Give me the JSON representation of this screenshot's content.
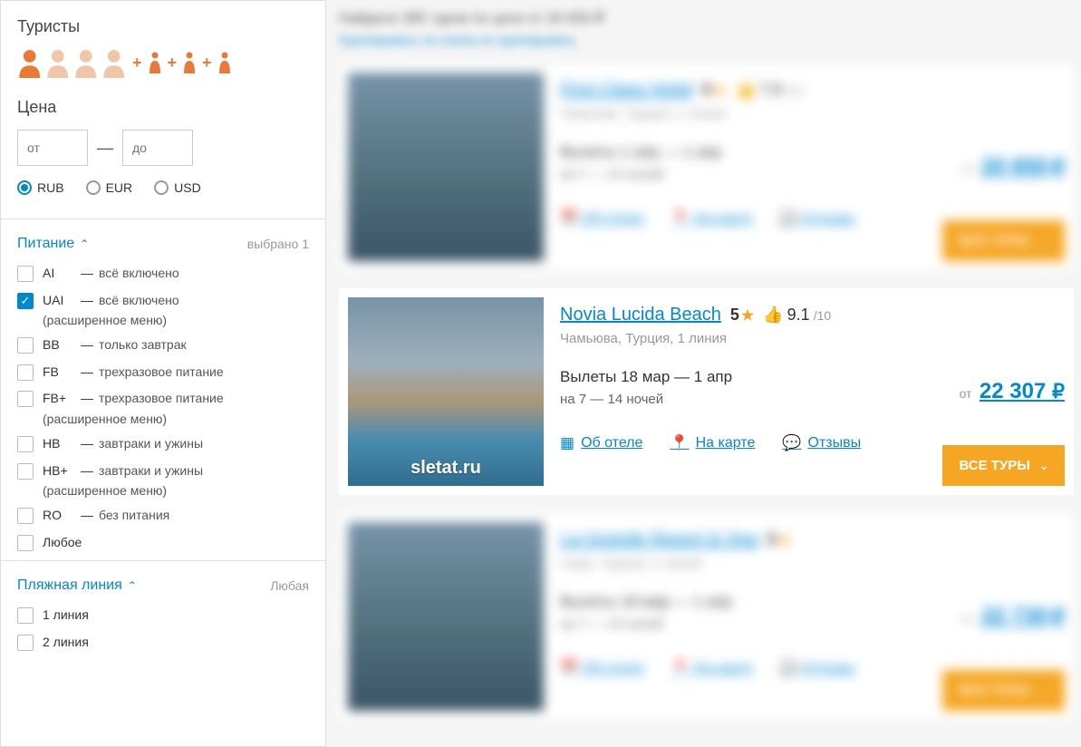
{
  "sidebar": {
    "tourists_title": "Туристы",
    "price_title": "Цена",
    "price_from_placeholder": "от",
    "price_to_placeholder": "до",
    "currencies": [
      {
        "code": "RUB",
        "checked": true
      },
      {
        "code": "EUR",
        "checked": false
      },
      {
        "code": "USD",
        "checked": false
      }
    ],
    "meal": {
      "title": "Питание",
      "selected_text": "выбрано 1",
      "options": [
        {
          "code": "AI",
          "desc": "всё включено",
          "sub": "",
          "checked": false
        },
        {
          "code": "UAI",
          "desc": "всё включено",
          "sub": "(расширенное меню)",
          "checked": true
        },
        {
          "code": "BB",
          "desc": "только завтрак",
          "sub": "",
          "checked": false
        },
        {
          "code": "FB",
          "desc": "трехразовое питание",
          "sub": "",
          "checked": false
        },
        {
          "code": "FB+",
          "desc": "трехразовое питание",
          "sub": "(расширенное меню)",
          "checked": false
        },
        {
          "code": "HB",
          "desc": "завтраки и ужины",
          "sub": "",
          "checked": false
        },
        {
          "code": "HB+",
          "desc": "завтраки и ужины",
          "sub": "(расширенное меню)",
          "checked": false
        },
        {
          "code": "RO",
          "desc": "без питания",
          "sub": "",
          "checked": false
        },
        {
          "code": "Любое",
          "desc": "",
          "sub": "",
          "checked": false
        }
      ]
    },
    "beach": {
      "title": "Пляжная линия",
      "selected_text": "Любая",
      "options": [
        {
          "label": "1 линия",
          "checked": false
        },
        {
          "label": "2 линия",
          "checked": false
        }
      ]
    }
  },
  "results_header": "Найдено 385 туров по цене от 20 650 ₽",
  "results_sub": "Группировать по отелю по группировать",
  "hotel": {
    "name": "Novia Lucida Beach",
    "stars": "5",
    "rating": "9.1",
    "rating_max": "/10",
    "location": "Чамьюва, Турция, 1 линия",
    "dates": "Вылеты 18 мар — 1 апр",
    "nights": "на 7  —  14 ночей",
    "watermark": "sletat.ru",
    "links": {
      "about": "Об отеле",
      "map": "На карте",
      "reviews": "Отзывы"
    },
    "price_from": "от",
    "price": "22 307",
    "currency": "₽",
    "all_tours": "ВСЕ ТУРЫ"
  },
  "blurred1": {
    "name": "First Class Hotel",
    "price": "20 650"
  },
  "blurred2": {
    "name": "La Grande Resort & Spa",
    "price": "22 730"
  }
}
